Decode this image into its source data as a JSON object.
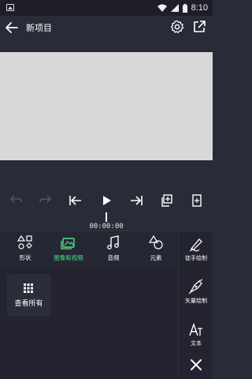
{
  "status_bar": {
    "time": "8:10"
  },
  "app_bar": {
    "title": "新项目",
    "back_icon": "arrow-left-icon",
    "settings_icon": "gear-icon",
    "export_icon": "export-icon"
  },
  "playback": {
    "timecode": "00:00:00",
    "buttons": [
      "undo-icon",
      "redo-icon",
      "skip-to-start-icon",
      "play-icon",
      "skip-to-end-icon",
      "duplicate-layer-icon",
      "bookmark-icon"
    ]
  },
  "tabs": [
    {
      "label": "形状",
      "icon": "shapes-icon",
      "active": false
    },
    {
      "label": "图像和视频",
      "icon": "image-video-icon",
      "active": true
    },
    {
      "label": "音频",
      "icon": "music-note-icon",
      "active": false
    },
    {
      "label": "元素",
      "icon": "elements-icon",
      "active": false
    }
  ],
  "content": {
    "view_all_label": "查看所有",
    "view_all_icon": "grid-icon"
  },
  "side_tools": [
    {
      "label": "徒手绘制",
      "icon": "freehand-pen-icon"
    },
    {
      "label": "矢量绘制",
      "icon": "vector-pen-icon"
    },
    {
      "label": "文本",
      "icon": "text-icon"
    },
    {
      "label": "",
      "icon": "close-icon"
    }
  ],
  "colors": {
    "accent": "#4ee08a",
    "background": "#2a2b38",
    "panel": "#232430",
    "canvas": "#d8d8d8"
  }
}
